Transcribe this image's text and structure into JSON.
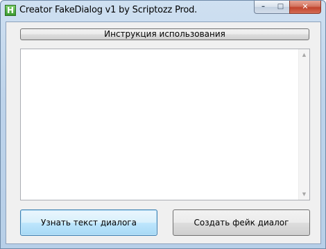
{
  "window": {
    "title": "Creator FakeDialog v1 by Scriptozz Prod.",
    "app_icon_letter": "H",
    "controls": {
      "minimize": "–",
      "maximize": "□",
      "close": "✕"
    }
  },
  "main": {
    "instructions_button": "Инструкция использования",
    "text_area_value": "",
    "scroll_up": "▲",
    "scroll_down": "▼",
    "learn_text_button": "Узнать текст диалога",
    "create_fake_button": "Создать фейк диалог"
  },
  "colors": {
    "accent_focus_border": "#3c7fb1",
    "close_button": "#c1432c"
  }
}
